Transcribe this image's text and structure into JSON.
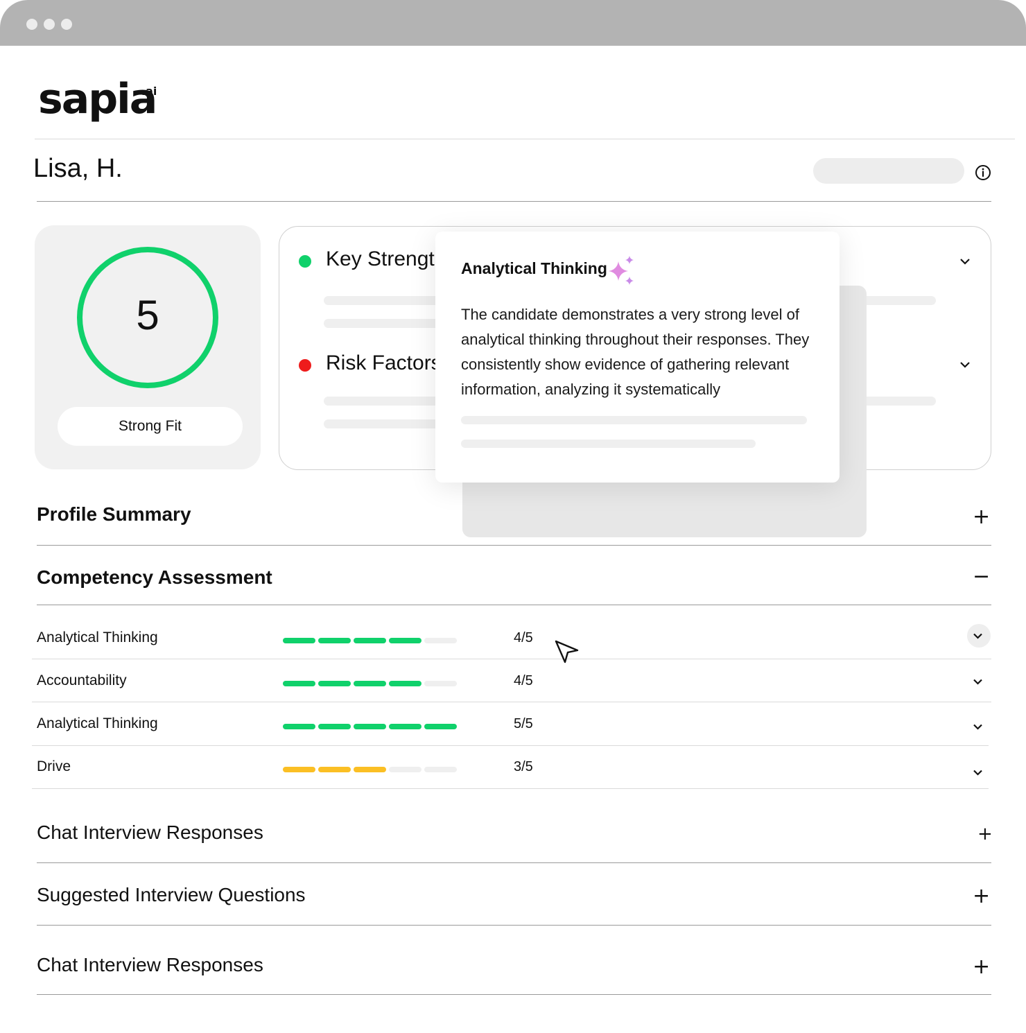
{
  "brand": {
    "logo_text": "sapia",
    "logo_suffix": ".ai"
  },
  "candidate": {
    "name": "Lisa, H."
  },
  "score": {
    "value": "5",
    "label": "Strong Fit",
    "ring_color": "#10d16b"
  },
  "factors": [
    {
      "label": "Key Strengths",
      "color": "#10d16b"
    },
    {
      "label": "Risk Factors",
      "color": "#ee1c1c"
    }
  ],
  "popup": {
    "title": "Analytical Thinking",
    "body": "The candidate demonstrates a very strong level of analytical thinking throughout their responses. They consistently show evidence of gathering relevant information, analyzing it systematically",
    "sparkle_color": "#e08be0"
  },
  "sections": {
    "profile_summary": {
      "title": "Profile Summary",
      "icon": "+"
    },
    "competency": {
      "title": "Competency Assessment",
      "icon": "−"
    },
    "chat_responses_1": {
      "title": "Chat Interview Responses",
      "icon": "+"
    },
    "suggested_questions": {
      "title": "Suggested Interview Questions",
      "icon": "+"
    },
    "chat_responses_2": {
      "title": "Chat Interview Responses",
      "icon": "+"
    }
  },
  "competencies": [
    {
      "name": "Analytical Thinking",
      "score_text": "4/5",
      "score": 4,
      "max": 5,
      "color": "#10d16b"
    },
    {
      "name": "Accountability",
      "score_text": "4/5",
      "score": 4,
      "max": 5,
      "color": "#10d16b"
    },
    {
      "name": "Analytical Thinking",
      "score_text": "5/5",
      "score": 5,
      "max": 5,
      "color": "#10d16b"
    },
    {
      "name": "Drive",
      "score_text": "3/5",
      "score": 3,
      "max": 5,
      "color": "#fbbf24"
    }
  ],
  "colors": {
    "empty_segment": "#efefef",
    "divider": "#dadada"
  }
}
